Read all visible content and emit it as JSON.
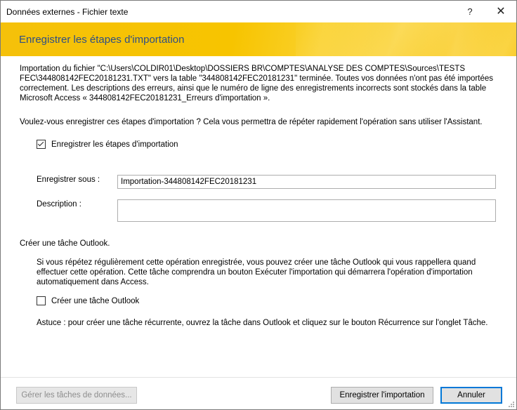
{
  "window": {
    "title": "Données externes - Fichier texte",
    "help_glyph": "?",
    "close_glyph": "✕"
  },
  "banner": {
    "title": "Enregistrer les étapes d'importation"
  },
  "info": {
    "line1": "Importation du fichier \"C:\\Users\\COLDIR01\\Desktop\\DOSSIERS BR\\COMPTES\\ANALYSE DES COMPTES\\Sources\\TESTS",
    "line2": "FEC\\344808142FEC20181231.TXT\" vers la table \"344808142FEC20181231\" terminée.  Toutes vos données n'ont pas été importées",
    "line3": "correctement. Les descriptions des erreurs, ainsi que le numéro de ligne des enregistrements incorrects sont stockés dans la table",
    "line4": "Microsoft Access « 344808142FEC20181231_Erreurs d'importation »."
  },
  "question": "Voulez-vous enregistrer ces étapes d'importation ? Cela vous permettra de répéter rapidement l'opération sans utiliser l'Assistant.",
  "save_steps": {
    "label": "Enregistrer les étapes d'importation",
    "checked": true
  },
  "save_as": {
    "label": "Enregistrer sous :",
    "value": "Importation-344808142FEC20181231"
  },
  "description": {
    "label": "Description :",
    "value": ""
  },
  "outlook": {
    "group_title": "Créer une tâche Outlook.",
    "desc_line1": "Si vous répétez régulièrement cette opération enregistrée, vous pouvez créer une tâche Outlook qui vous rappellera quand",
    "desc_line2": "effectuer cette opération. Cette tâche comprendra un bouton Exécuter l'importation qui démarrera l'opération d'importation",
    "desc_line3": "automatiquement dans Access.",
    "checkbox_label": "Créer une tâche Outlook",
    "checked": false,
    "tip": "Astuce : pour créer une tâche récurrente, ouvrez la tâche dans Outlook et cliquez sur le bouton Récurrence sur l'onglet Tâche."
  },
  "buttons": {
    "manage": "Gérer les tâches de données...",
    "save_import": "Enregistrer l'importation",
    "cancel": "Annuler"
  }
}
